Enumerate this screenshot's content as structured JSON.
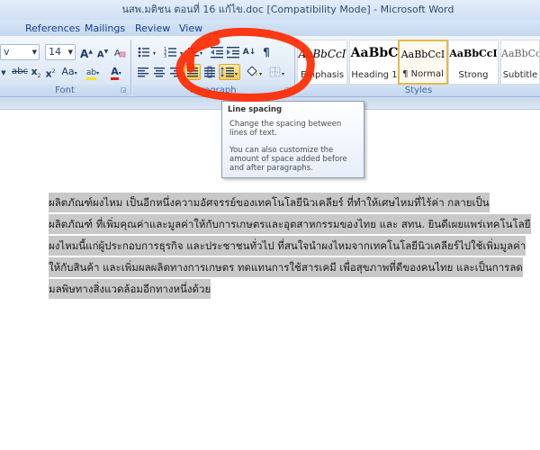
{
  "window": {
    "title": "นสพ.มติชน ตอนที่ 16 แก้ไข.doc [Compatibility Mode] - Microsoft Word"
  },
  "tabs": [
    "References",
    "Mailings",
    "Review",
    "View"
  ],
  "ribbon": {
    "font": {
      "font_name_fragment": "v",
      "font_size": "14",
      "group_label": "Font",
      "grow_font": "A",
      "shrink_font": "A",
      "change_case": "Aa",
      "strikethrough": "abc",
      "subscript": "x",
      "superscript": "x",
      "font_color_letter": "A",
      "highlight_letter": "ab"
    },
    "paragraph": {
      "group_label": "Paragraph",
      "sort": "A↓"
    },
    "styles": {
      "group_label": "Styles",
      "cards": [
        {
          "sample": "AaBbCcI",
          "name": "Emphasis"
        },
        {
          "sample": "AaBbC",
          "name": "Heading 1"
        },
        {
          "sample": "AaBbCcI",
          "name": "¶ Normal"
        },
        {
          "sample": "AaBbCcI",
          "name": "Strong"
        },
        {
          "sample": "AaBbCcI",
          "name": "Subtitle"
        }
      ]
    }
  },
  "tooltip": {
    "title": "Line spacing",
    "text1": "Change the spacing between lines of text.",
    "text2": "You can also customize the amount of space added before and after paragraphs."
  },
  "document": {
    "lines": [
      "            ผลิตภัณฑ์ผงไหม เป็นอีกหนึ่งความอัศจรรย์ของเทคโนโลยีนิวเคลียร์ ที่ทำให้เศษไหมที่ไร้ค่า กลายเป็น",
      "ผลิตภัณฑ์ ที่เพิ่มคุณค่าและมูลค่าให้กับการเกษตรและอุตสาหกรรมของไทย และ สทน. ยินดีเผยแพร่เทคโนโลยี",
      "ผงไหมนี้แก่ผู้ประกอบการธุรกิจ และประชาชนทั่วไป ที่สนใจนำผงไหมจากเทคโนโลยีนิวเคลียร์ไปใช้เพิ่มมูลค่า",
      "ให้กับสินค้า และเพิ่มผลผลิตทางการเกษตร ทดแทนการใช้สารเคมี เพื่อสุขภาพที่ดีของคนไทย และเป็นการลด",
      "มลพิษทางสิ่งแวดล้อมอีกทางหนึ่งด้วย  "
    ]
  },
  "colors": {
    "annotation": "#ff2a00",
    "selection": "#c8c8c8",
    "hover_button": "#f7cc58"
  }
}
